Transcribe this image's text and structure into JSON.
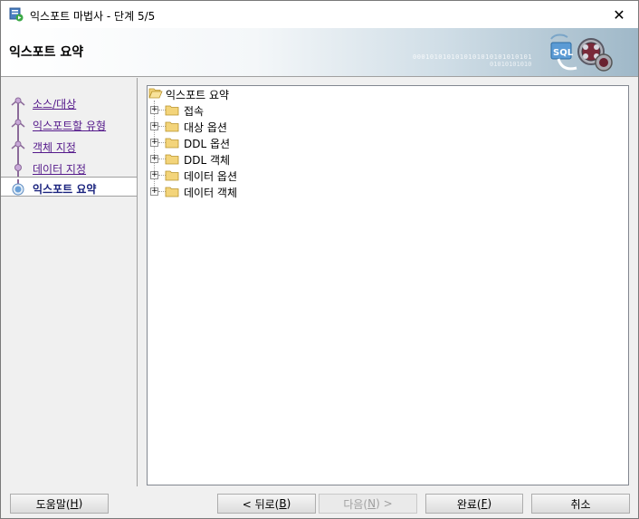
{
  "window": {
    "title": "익스포트 마법사 - 단계 5/5",
    "close_glyph": "✕"
  },
  "banner": {
    "heading": "익스포트 요약",
    "binary_text_1": "0001010101010101010101010101",
    "binary_text_2": "01010101010",
    "logo_text": "SQL"
  },
  "nav": {
    "steps": [
      {
        "label": "소스/대상",
        "state": "visited"
      },
      {
        "label": "익스포트할 유형",
        "state": "visited"
      },
      {
        "label": "객체 지정",
        "state": "visited"
      },
      {
        "label": "데이터 지정",
        "state": "visited"
      },
      {
        "label": "익스포트 요약",
        "state": "current"
      }
    ]
  },
  "tree": {
    "root_label": "익스포트 요약",
    "nodes": [
      {
        "label": "접속"
      },
      {
        "label": "대상 옵션"
      },
      {
        "label": "DDL 옵션"
      },
      {
        "label": "DDL 객체"
      },
      {
        "label": "데이터 옵션"
      },
      {
        "label": "데이터 객체"
      }
    ],
    "expander_glyph": "+"
  },
  "buttons": {
    "help": {
      "text": "도움말(",
      "mnemonic": "H",
      "suffix": ")"
    },
    "back": {
      "text": "< 뒤로(",
      "mnemonic": "B",
      "suffix": ")"
    },
    "next": {
      "text": "다음(",
      "mnemonic": "N",
      "suffix": ") >"
    },
    "finish": {
      "text": "완료(",
      "mnemonic": "F",
      "suffix": ")"
    },
    "cancel": {
      "text": "취소"
    }
  },
  "colors": {
    "visited_link": "#551a8b",
    "current_step": "#1a237e",
    "folder": "#e8c04a",
    "step_node": "#9c6fae"
  }
}
